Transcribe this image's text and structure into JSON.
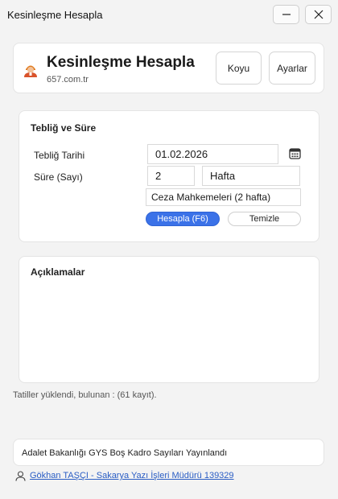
{
  "window": {
    "title": "Kesinleşme Hesapla"
  },
  "header": {
    "app_name": "Kesinleşme Hesapla",
    "url": "657.com.tr",
    "theme_button": "Koyu",
    "settings_button": "Ayarlar"
  },
  "form": {
    "section_title": "Tebliğ ve Süre",
    "date_label": "Tebliğ Tarihi",
    "date_value": "01.02.2026",
    "duration_label": "Süre (Sayı)",
    "duration_value": "2",
    "unit_value": "Hafta",
    "court_value": "Ceza Mahkemeleri (2 hafta)",
    "calculate_button": "Hesapla (F6)",
    "clear_button": "Temizle"
  },
  "description": {
    "title": "Açıklamalar"
  },
  "status": {
    "text": "Tatiller yüklendi, bulunan : (61 kayıt)."
  },
  "news": {
    "text": "Adalet Bakanlığı GYS Boş Kadro Sayıları Yayınlandı"
  },
  "footer": {
    "author_link": "Gökhan TAŞÇI - Sakarya Yazı İşleri Müdürü 139329"
  },
  "colors": {
    "accent": "#3b72e8",
    "link": "#2a5dc4"
  }
}
